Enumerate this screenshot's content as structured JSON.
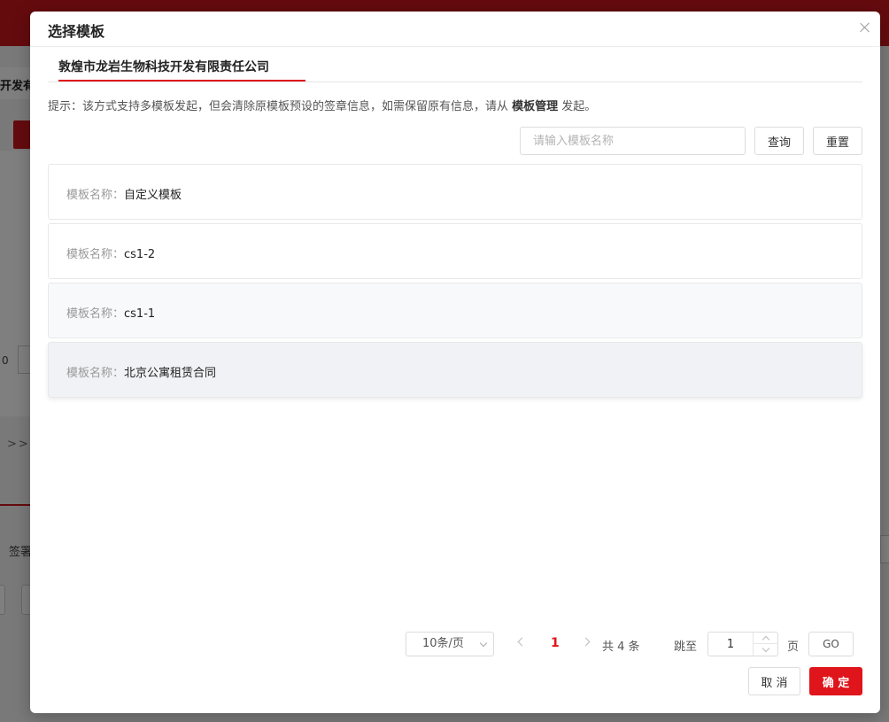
{
  "background": {
    "tab_text": "开发有",
    "arrows": ">>",
    "sign_text": "签署",
    "input_prefix": "0"
  },
  "modal": {
    "title": "选择模板",
    "tab": "敦煌市龙岩生物科技开发有限责任公司",
    "hint_prefix": "提示：该方式支持多模板发起，但会清除原模板预设的签章信息，如需保留原有信息，请从 ",
    "hint_strong": "模板管理",
    "hint_suffix": " 发起。",
    "search_placeholder": "请输入模板名称",
    "query_label": "查询",
    "reset_label": "重置",
    "items": [
      {
        "label": "模板名称：",
        "value": "自定义模板"
      },
      {
        "label": "模板名称：",
        "value": "cs1-2"
      },
      {
        "label": "模板名称：",
        "value": "cs1-1"
      },
      {
        "label": "模板名称：",
        "value": "北京公寓租赁合同"
      }
    ],
    "pagination": {
      "page_size": "10条/页",
      "current_page": "1",
      "total": "共 4 条",
      "jump_label": "跳至",
      "jump_value": "1",
      "page_suffix": "页",
      "go_label": "GO"
    },
    "cancel_label": "取 消",
    "ok_label": "确 定"
  },
  "colors": {
    "accent": "#e0141b",
    "topbar": "#c8161d"
  }
}
